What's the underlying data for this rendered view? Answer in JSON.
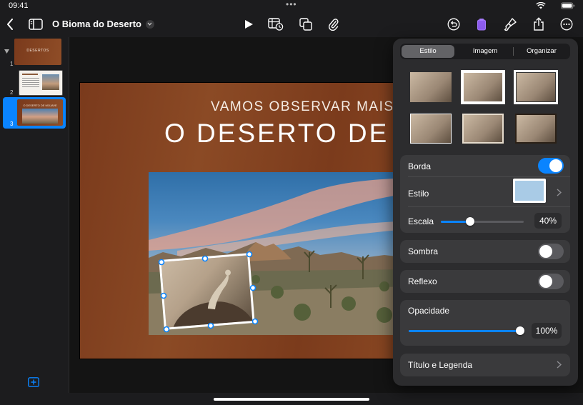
{
  "status": {
    "time": "09:41"
  },
  "app": {
    "doc_title": "O Bioma do Deserto"
  },
  "navigator": {
    "slides": [
      {
        "num": "1",
        "title": "DESERTOS"
      },
      {
        "num": "2",
        "title": ""
      },
      {
        "num": "3",
        "title": "O DESERTO DE MOJAVE"
      }
    ]
  },
  "slide": {
    "subtitle": "VAMOS OBSERVAR MAIS DE",
    "title": "O DESERTO DE M"
  },
  "panel": {
    "tabs": [
      "Estilo",
      "Imagem",
      "Organizar"
    ],
    "selected_tab": "Estilo",
    "borda_label": "Borda",
    "borda_on": true,
    "estilo_label": "Estilo",
    "escala_label": "Escala",
    "escala_value": "40%",
    "escala_fraction": 0.35,
    "sombra_label": "Sombra",
    "sombra_on": false,
    "reflexo_label": "Reflexo",
    "reflexo_on": false,
    "opacidade_label": "Opacidade",
    "opacidade_value": "100%",
    "opacidade_fraction": 1.0,
    "titulo_label": "Título e Legenda"
  },
  "colors": {
    "accent": "#0a84ff",
    "toggle_off": "#5a5a5e",
    "slide_brown": "#7f3f1f"
  }
}
